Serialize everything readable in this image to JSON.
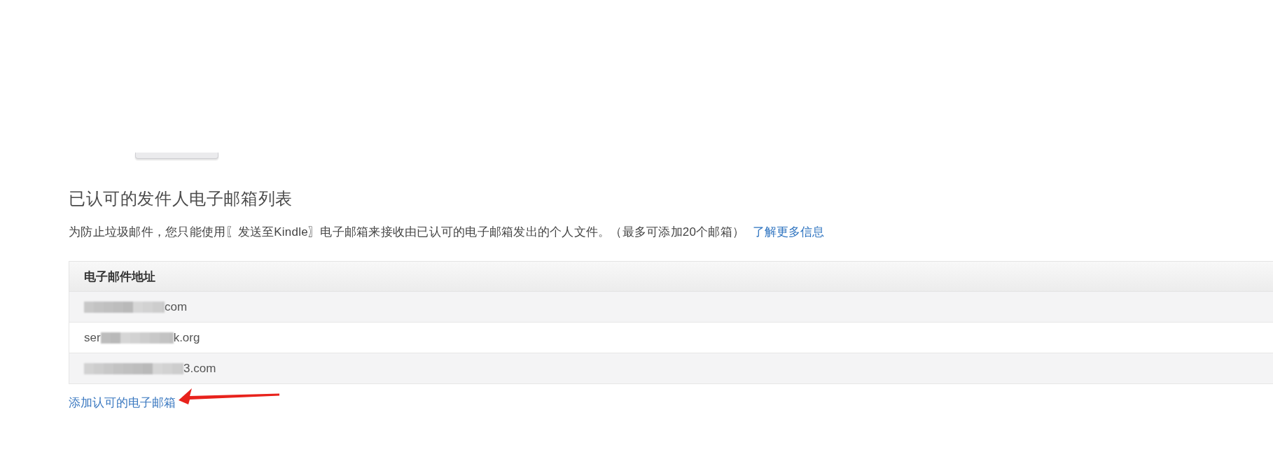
{
  "section": {
    "title": "已认可的发件人电子邮箱列表",
    "description": "为防止垃圾邮件，您只能使用〖发送至Kindle〗电子邮箱来接收由已认可的电子邮箱发出的个人文件。（最多可添加20个邮箱）",
    "learn_more_link": "了解更多信息"
  },
  "table": {
    "columns": [
      "电子邮件地址"
    ],
    "rows": [
      {
        "redacted": true,
        "email_end": "com"
      },
      {
        "email_start": "ser",
        "redacted": true,
        "email_end": "k.org"
      },
      {
        "redacted": true,
        "email_end": "3.com"
      }
    ]
  },
  "add_link": "添加认可的电子邮箱"
}
